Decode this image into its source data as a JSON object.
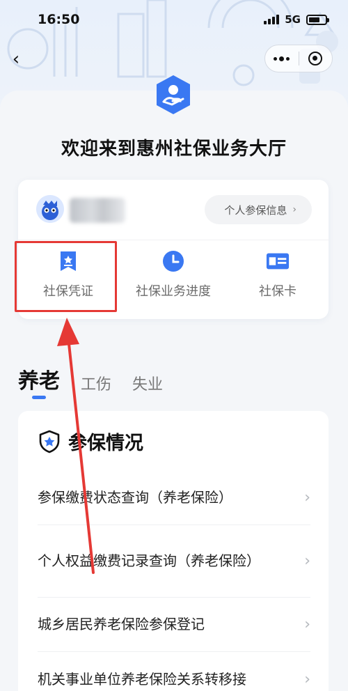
{
  "status_bar": {
    "time": "16:50",
    "network": "5G"
  },
  "hall": {
    "title": "欢迎来到惠州社保业务大厅"
  },
  "user_card": {
    "info_button": "个人参保信息",
    "quick_actions": [
      {
        "label": "社保凭证",
        "icon": "certificate-icon"
      },
      {
        "label": "社保业务进度",
        "icon": "clock-icon"
      },
      {
        "label": "社保卡",
        "icon": "card-icon"
      }
    ]
  },
  "tabs": [
    {
      "label": "养老",
      "active": true
    },
    {
      "label": "工伤",
      "active": false
    },
    {
      "label": "失业",
      "active": false
    }
  ],
  "services": {
    "title": "参保情况",
    "items": [
      "参保缴费状态查询（养老保险）",
      "个人权益缴费记录查询（养老保险）",
      "城乡居民养老保险参保登记",
      "机关事业单位养老保险关系转移接"
    ]
  },
  "colors": {
    "accent": "#3a78f2",
    "highlight": "#e53935"
  }
}
